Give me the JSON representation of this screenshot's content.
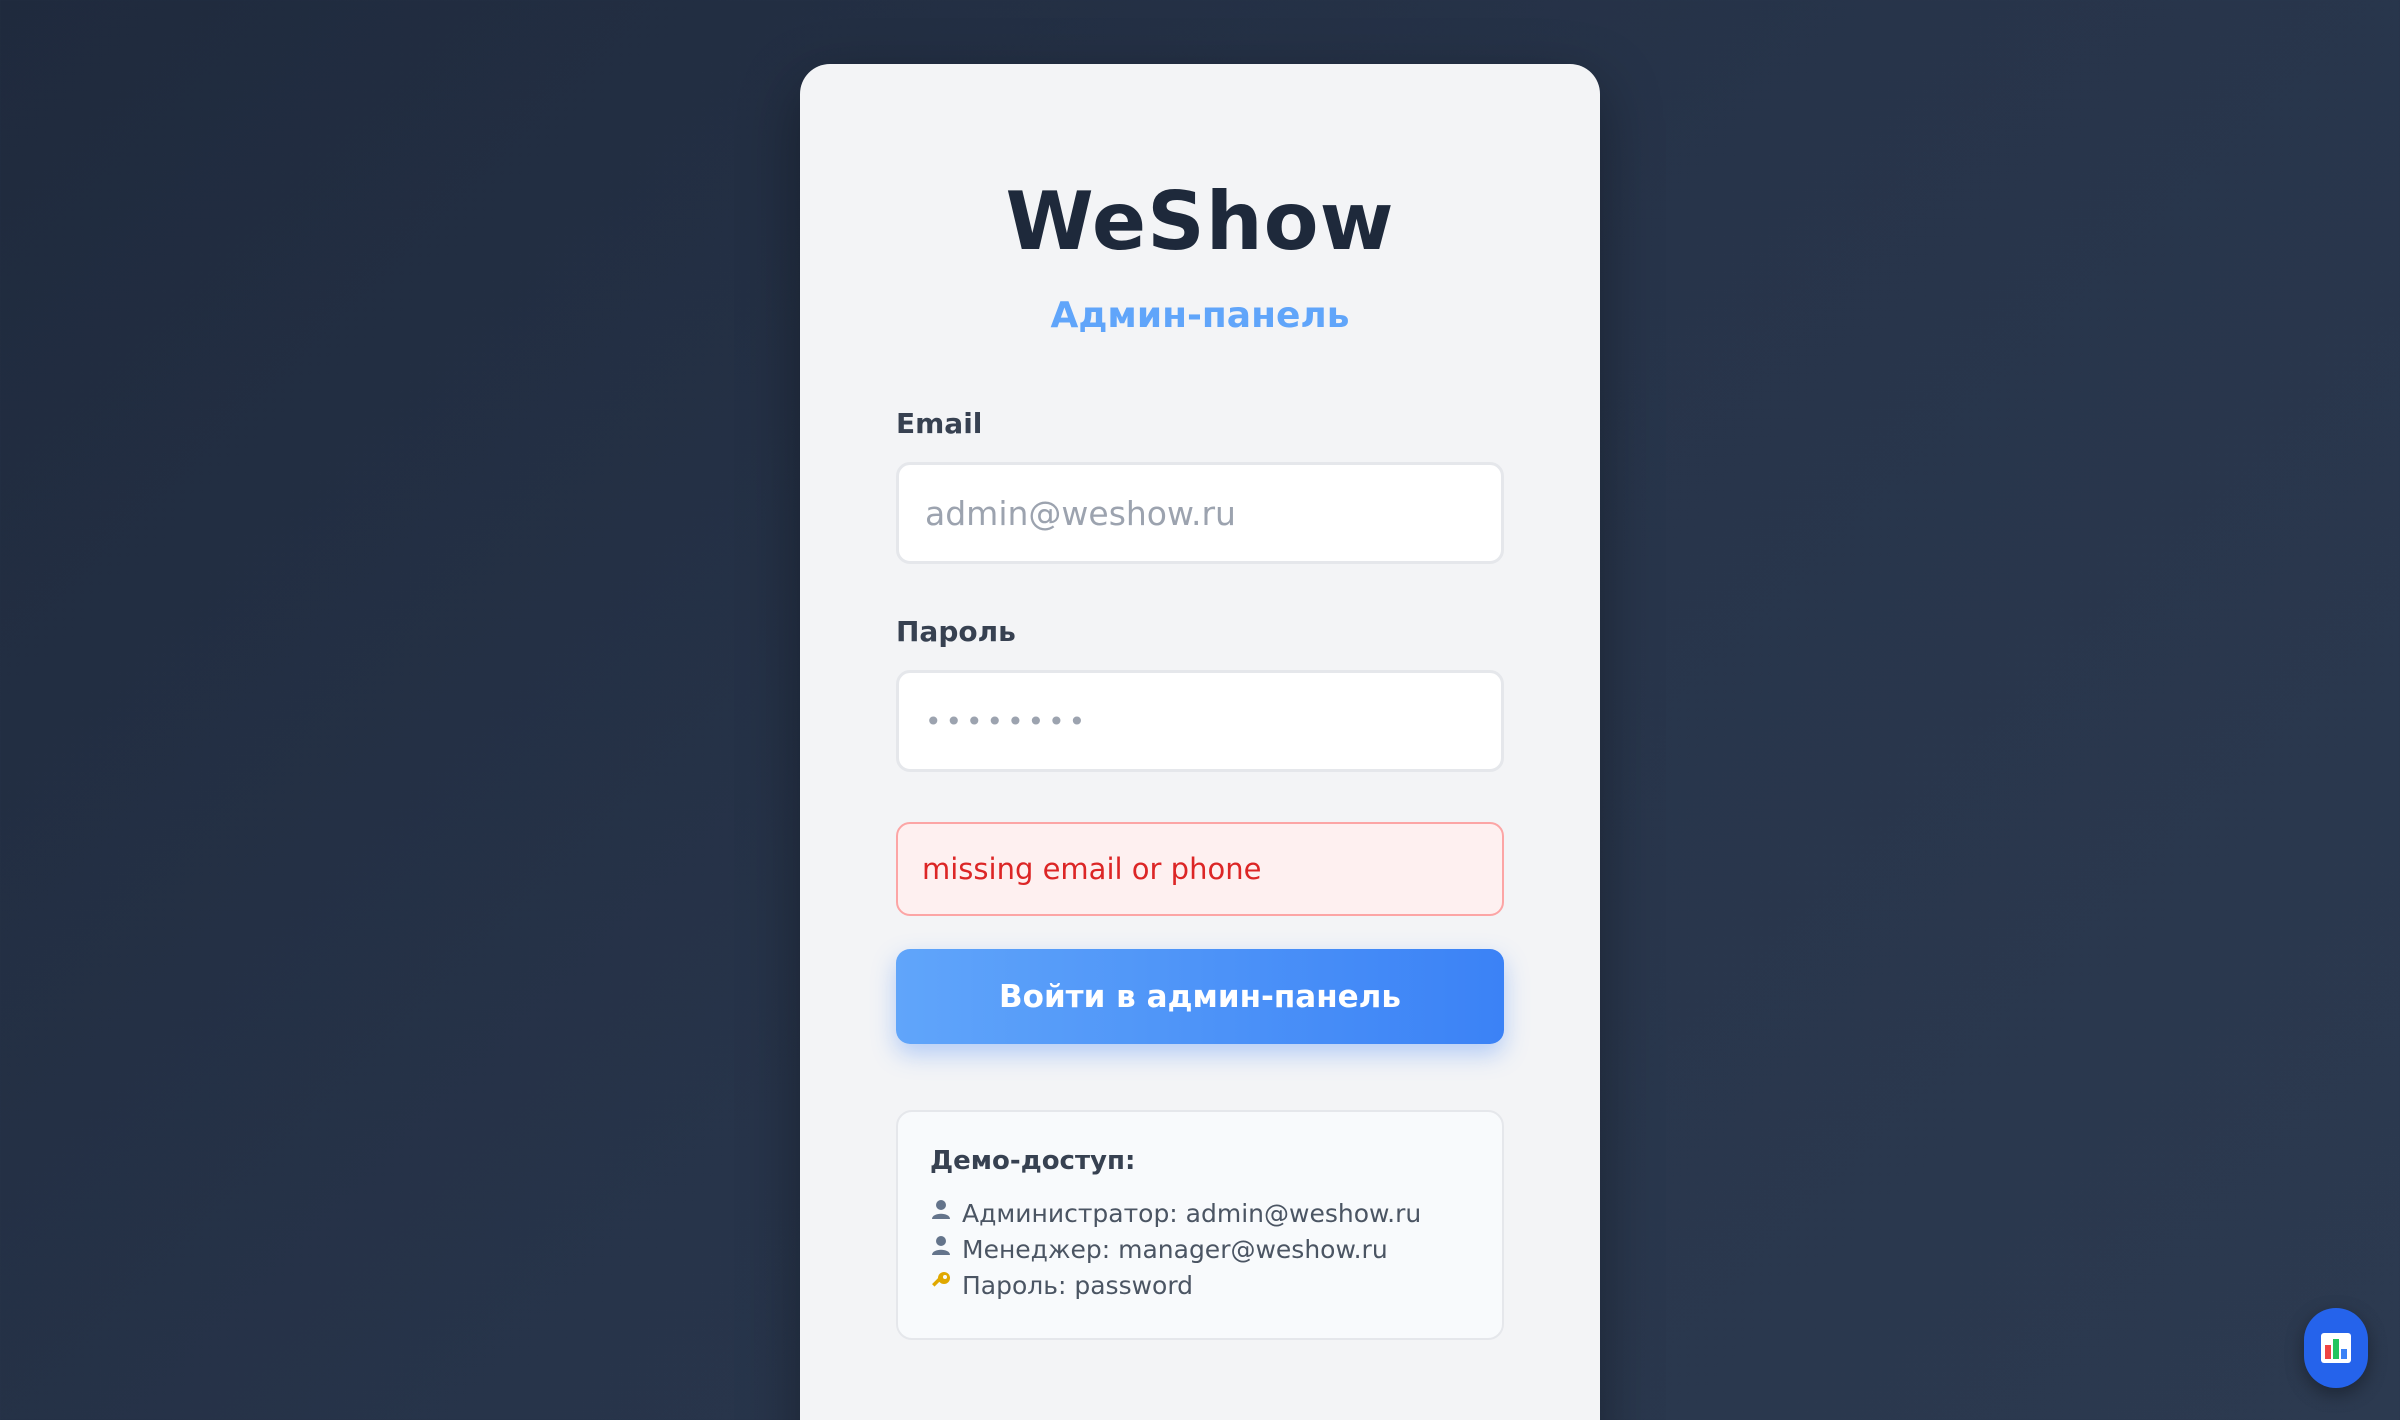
{
  "brand": {
    "title": "WeShow",
    "subtitle": "Админ-панель"
  },
  "form": {
    "email_label": "Email",
    "email_placeholder": "admin@weshow.ru",
    "email_value": "",
    "password_label": "Пароль",
    "password_placeholder": "••••••••",
    "password_value": "",
    "error_message": "missing email or phone",
    "submit_label": "Войти в админ-панель"
  },
  "demo": {
    "title": "Демо-доступ:",
    "lines": [
      {
        "icon": "user-icon",
        "text": "Администратор: admin@weshow.ru"
      },
      {
        "icon": "user-icon",
        "text": "Менеджер: manager@weshow.ru"
      },
      {
        "icon": "key-icon",
        "text": "Пароль: password"
      }
    ]
  },
  "floating_button": {
    "icon": "bar-chart-icon"
  },
  "colors": {
    "accent": "#3b82f6",
    "subtitle": "#60a5fa",
    "error_text": "#dc2626",
    "error_bg": "#fef0f0",
    "background": "#1f2a3d"
  }
}
